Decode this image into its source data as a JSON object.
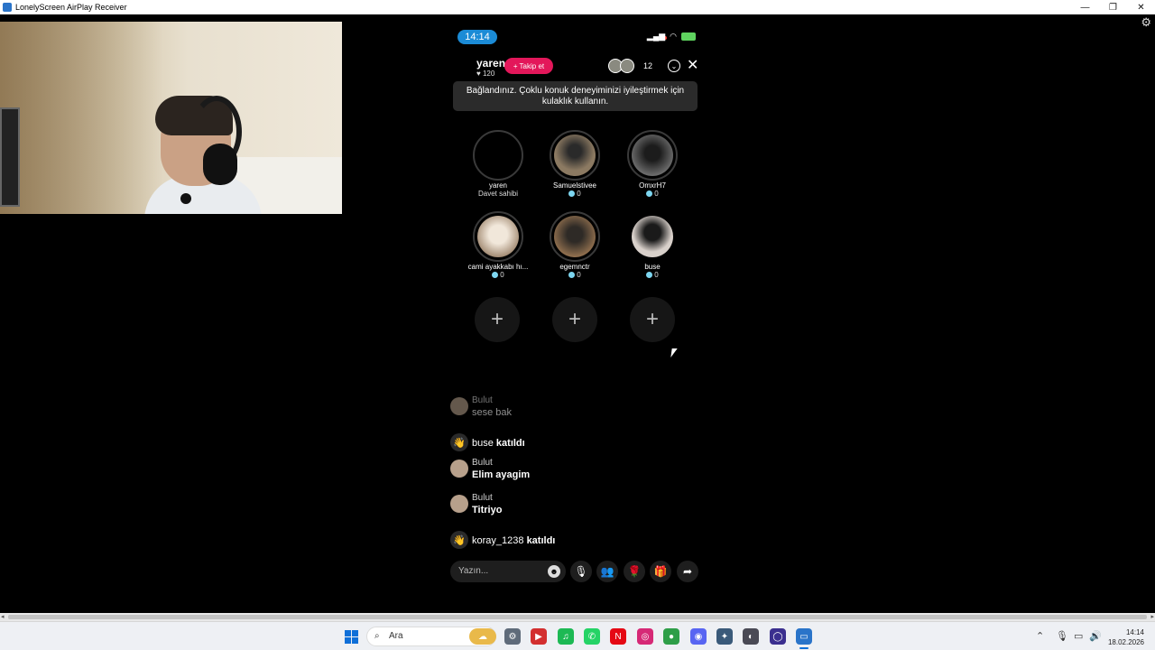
{
  "window": {
    "title": "LonelyScreen AirPlay Receiver",
    "controls": [
      "—",
      "❐",
      "✕"
    ]
  },
  "phone": {
    "status": {
      "time": "14:14"
    },
    "host": {
      "name": "yaren",
      "likes": "120",
      "follow_label": "Takip et",
      "viewer_count": "12"
    },
    "toast": "Bağlandınız. Çoklu konuk deneyiminizi iyileştirmek için kulaklık kullanın.",
    "guests": [
      {
        "name": "yaren",
        "sub": "Davet sahibi",
        "gems": null,
        "color": "#000000"
      },
      {
        "name": "Samuelstivee",
        "sub": null,
        "gems": "0",
        "color": "#6b5c4a"
      },
      {
        "name": "OmxrH7",
        "sub": null,
        "gems": "0",
        "color": "#555555"
      },
      {
        "name": "cami ayakkabı hı...",
        "sub": null,
        "gems": "0",
        "color": "#d9c9b4"
      },
      {
        "name": "egemnctr",
        "sub": null,
        "gems": "0",
        "color": "#6e5a44"
      },
      {
        "name": "buse",
        "sub": null,
        "gems": "0",
        "color": "#cfc7c2"
      }
    ],
    "add_slot_symbol": "+",
    "chat": [
      {
        "type": "msg",
        "user": "Bulut",
        "text": "sese bak",
        "faded": true
      },
      {
        "type": "join",
        "user": "buse",
        "text": "katıldı"
      },
      {
        "type": "msg",
        "user": "Bulut",
        "text": "Elim ayagim"
      },
      {
        "type": "msg",
        "user": "Bulut",
        "text": "Titriyo"
      },
      {
        "type": "join",
        "user": "koray_1238",
        "text": "katıldı"
      }
    ],
    "composer": {
      "placeholder": "Yazın..."
    }
  },
  "taskbar": {
    "search_label": "Ara",
    "time": "14:14",
    "date": "18.02.2026",
    "apps": [
      {
        "name": "weather-widget-icon",
        "glyph": "☁",
        "color": "#e9b94a"
      },
      {
        "name": "settings-icon",
        "glyph": "⚙",
        "color": "#5f6b7a"
      },
      {
        "name": "app-red-icon",
        "glyph": "▶",
        "color": "#d32f2f"
      },
      {
        "name": "spotify-icon",
        "glyph": "♫",
        "color": "#1db954"
      },
      {
        "name": "whatsapp-icon",
        "glyph": "✆",
        "color": "#25d366"
      },
      {
        "name": "netflix-icon",
        "glyph": "N",
        "color": "#e50914"
      },
      {
        "name": "instagram-icon",
        "glyph": "◎",
        "color": "#d62976"
      },
      {
        "name": "chrome-icon",
        "glyph": "●",
        "color": "#2e9e48"
      },
      {
        "name": "discord-icon",
        "glyph": "◉",
        "color": "#5865f2"
      },
      {
        "name": "app-network-icon",
        "glyph": "✦",
        "color": "#3a5a7a"
      },
      {
        "name": "steam-icon",
        "glyph": "◐",
        "color": "#4a4a55"
      },
      {
        "name": "app-purple-icon",
        "glyph": "◯",
        "color": "#3b2f8f"
      },
      {
        "name": "lonelyscreen-icon",
        "glyph": "▭",
        "color": "#2a74c9"
      }
    ]
  }
}
